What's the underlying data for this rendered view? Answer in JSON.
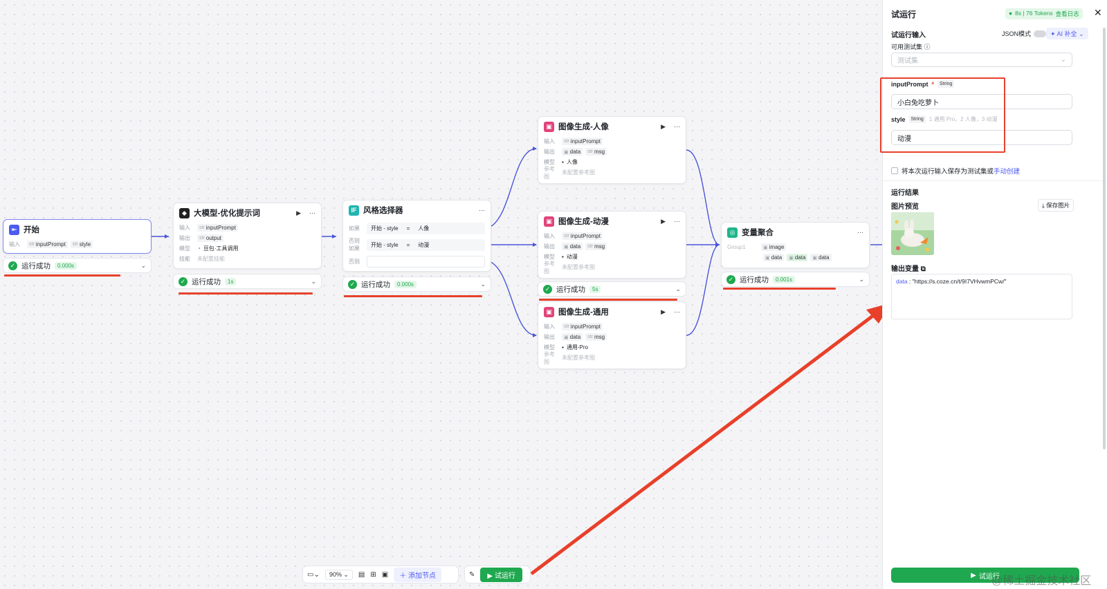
{
  "canvas": {
    "start_node": {
      "title": "开始",
      "in_label": "输入",
      "vars": [
        "inputPrompt",
        "style"
      ],
      "type": "str"
    },
    "llm_node": {
      "title": "大模型-优化提示词",
      "in_label": "输入",
      "in_val": "inputPrompt",
      "out_label": "输出",
      "out_val": "output",
      "model_label": "模型",
      "model_val": "豆包·工具调用",
      "skill_label": "技能",
      "skill_val": "未配置技能"
    },
    "selector_node": {
      "title": "风格选择器",
      "if_label": "如果",
      "elif_label": "否则如果",
      "else_label": "否则",
      "src": "开始 - style",
      "eq": "=",
      "val1": "人像",
      "val2": "动漫"
    },
    "img_nodes": [
      {
        "title": "图像生成-人像",
        "in_label": "输入",
        "in_val": "inputPrompt",
        "out_label": "输出",
        "out1": "data",
        "out2": "msg",
        "model_label": "模型",
        "model_val": "人像",
        "ref_label": "参考图",
        "ref_val": "未配置参考图"
      },
      {
        "title": "图像生成-动漫",
        "in_label": "输入",
        "in_val": "inputPrompt",
        "out_label": "输出",
        "out1": "data",
        "out2": "msg",
        "model_label": "模型",
        "model_val": "动漫",
        "ref_label": "参考图",
        "ref_val": "未配置参考图"
      },
      {
        "title": "图像生成-通用",
        "in_label": "输入",
        "in_val": "inputPrompt",
        "out_label": "输出",
        "out1": "data",
        "out2": "msg",
        "model_label": "模型",
        "model_val": "通用-Pro",
        "ref_label": "参考图",
        "ref_val": "未配置参考图"
      }
    ],
    "agg_node": {
      "title": "变量聚合",
      "group": "Group1",
      "image": "image",
      "data": "data"
    },
    "statuses": [
      {
        "text": "运行成功",
        "time": "0.000s"
      },
      {
        "text": "运行成功",
        "time": "1s"
      },
      {
        "text": "运行成功",
        "time": "0.000s"
      },
      {
        "text": "运行成功",
        "time": "5s"
      },
      {
        "text": "运行成功",
        "time": "0.001s"
      }
    ]
  },
  "toolbar": {
    "zoom": "90%",
    "add_node": "添加节点",
    "test_run": "试运行"
  },
  "panel": {
    "title": "试运行",
    "badge": "8s | 76 Tokens",
    "log_link": "查看日志",
    "input_title": "试运行输入",
    "json_mode": "JSON模式",
    "ai_fill": "AI 补全",
    "testset_label": "可用测试集",
    "testset_placeholder": "测试集",
    "field1_name": "inputPrompt",
    "field1_type": "String",
    "field1_value": "小白兔吃萝卜",
    "field2_name": "style",
    "field2_type": "String",
    "field2_hint": "1 通用 Pro，2 人像，3 动漫",
    "field2_value": "动漫",
    "save_text": "将本次运行输入保存为测试集或",
    "save_link": "手动创建",
    "result_title": "运行结果",
    "preview_title": "图片预览",
    "save_image": "保存图片",
    "output_title": "输出变量",
    "output_key": "data",
    "output_value": "\"https://s.coze.cn/t/9I7VHvwmPCw/\"",
    "run_button": "试运行",
    "watermark": "@稀土掘金技术社区"
  }
}
